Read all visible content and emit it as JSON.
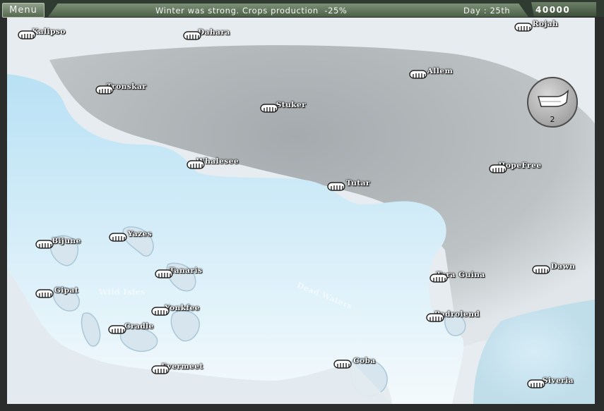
{
  "topbar": {
    "menu_label": "Menu",
    "status_message": "Winter was strong. Crops production  -25%",
    "day_label": "Day : 25th",
    "money": "40000"
  },
  "ships": {
    "count": "2",
    "icon": "ship-icon"
  },
  "regions": {
    "wild_isles": "Wild Isles",
    "dead_waters": "Dead Waters"
  },
  "cities": [
    {
      "name": "Kalipso"
    },
    {
      "name": "Dahara"
    },
    {
      "name": "Rojah"
    },
    {
      "name": "Tronskar"
    },
    {
      "name": "Allem"
    },
    {
      "name": "Stuker"
    },
    {
      "name": "Whalesee"
    },
    {
      "name": "HopeFree"
    },
    {
      "name": "Tutar"
    },
    {
      "name": "Yazes"
    },
    {
      "name": "Bijune"
    },
    {
      "name": "Tanaris"
    },
    {
      "name": "Tera Guina"
    },
    {
      "name": "Dawn"
    },
    {
      "name": "Gipat"
    },
    {
      "name": "Yonkfee"
    },
    {
      "name": "Padrolend"
    },
    {
      "name": "Cradle"
    },
    {
      "name": "Evermeet"
    },
    {
      "name": "Coba"
    },
    {
      "name": "Siveria"
    }
  ],
  "colors": {
    "ice": "#e9eff2",
    "rock": "#a3a9ab",
    "water": "#c6e6f5",
    "topbar": "#56684f"
  }
}
